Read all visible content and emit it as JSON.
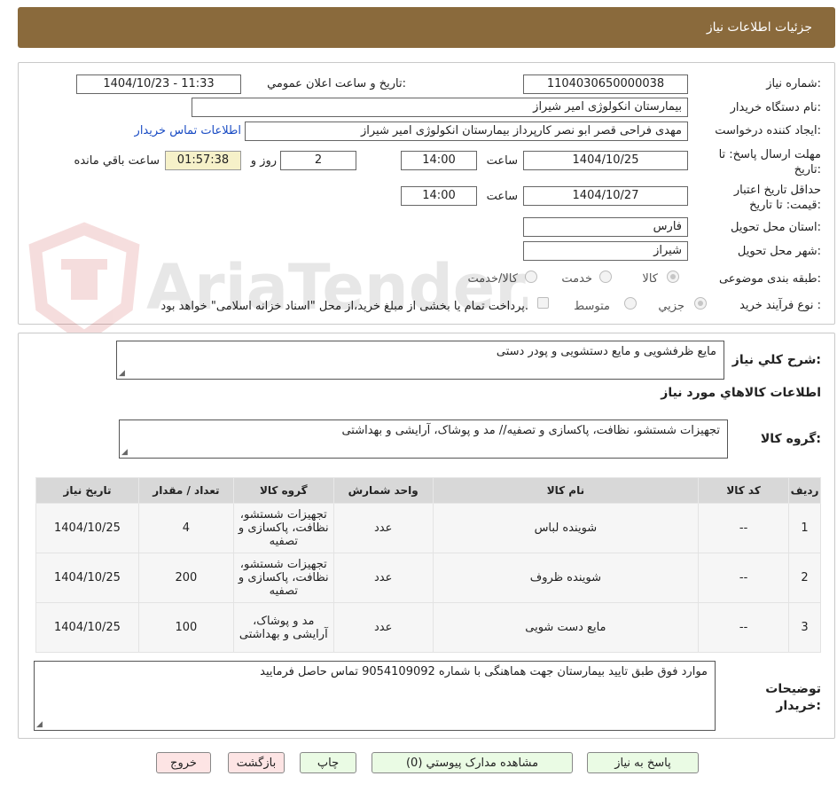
{
  "header": {
    "title": "جزئیات اطلاعات نیاز"
  },
  "form": {
    "need_number_label": "شماره نیاز:",
    "need_number": "1104030650000038",
    "announce_label": "تاریخ و ساعت اعلان عمومي:",
    "announce_value": "1404/10/23 - 11:33",
    "buyer_org_label": "نام دستگاه خریدار:",
    "buyer_org": "بیمارستان انکولوژی امیر شیراز",
    "creator_label": "ایجاد کننده درخواست:",
    "creator": "مهدی فراحی قصر ابو نصر کارپرداز بیمارستان انکولوژی امیر شیراز",
    "buyer_contact_link": "اطلاعات تماس خریدار",
    "deadline_label": "مهلت ارسال پاسخ: تا تاریخ:",
    "deadline_date": "1404/10/25",
    "time_label": "ساعت",
    "deadline_time": "14:00",
    "days_value": "2",
    "days_label": "روز و",
    "remaining_time": "01:57:38",
    "remaining_label": "ساعت باقي مانده",
    "price_validity_label": "حداقل تاریخ اعتبار قیمت: تا تاریخ:",
    "price_validity_date": "1404/10/27",
    "price_validity_time": "14:00",
    "province_label": "استان محل تحویل:",
    "province": "فارس",
    "city_label": "شهر محل تحویل:",
    "city": "شیراز",
    "category_label": "طبقه بندی موضوعی:",
    "category_options": [
      "کالا",
      "خدمت",
      "کالا/خدمت"
    ],
    "process_label": "نوع فرآیند خرید :",
    "process_options": [
      "جزیي",
      "متوسط"
    ],
    "payment_note": "پرداخت تمام یا بخشی از مبلغ خرید،از محل \"اسناد خزانه اسلامی\" خواهد بود."
  },
  "details": {
    "summary_label": "شرح کلي نیاز:",
    "summary": "مایع ظرفشویی و مایع دستشویی و پودر دستی",
    "goods_section_title": "اطلاعات کالاهاي مورد نیاز",
    "goods_group_label": "گروه کالا:",
    "goods_group": "تجهیزات شستشو، نظافت، پاکسازی و تصفیه// مد و پوشاک، آرایشی و بهداشتی"
  },
  "table": {
    "headers": [
      "ردیف",
      "کد کالا",
      "نام کالا",
      "واحد شمارش",
      "گروه کالا",
      "تعداد / مقدار",
      "تاریخ نیاز"
    ],
    "rows": [
      [
        "1",
        "--",
        "شوینده لباس",
        "عدد",
        "تجهیزات شستشو، نظافت، پاکسازی و تصفیه",
        "4",
        "1404/10/25"
      ],
      [
        "2",
        "--",
        "شوینده ظروف",
        "عدد",
        "تجهیزات شستشو، نظافت، پاکسازی و تصفیه",
        "200",
        "1404/10/25"
      ],
      [
        "3",
        "--",
        "مایع دست شویی",
        "عدد",
        "مد و پوشاک، آرایشی و بهداشتی",
        "100",
        "1404/10/25"
      ]
    ]
  },
  "notes": {
    "label": "توضیحات خریدار:",
    "text": "موارد فوق طبق تایید بیمارستان جهت هماهنگی با شماره 9054109092 تماس حاصل فرمایید"
  },
  "buttons": {
    "reply": "پاسخ به نیاز",
    "attachments": "مشاهده مدارک پیوستي (0)",
    "print": "چاپ",
    "back": "بازگشت",
    "exit": "خروج"
  },
  "watermark": {
    "text": "AriaTender.neT"
  },
  "colors": {
    "header_bg": "#8a6a3c",
    "link": "#1a4cc4",
    "button_green": "#eafbe4",
    "button_pink": "#fde4e4",
    "timer_bg": "#f6f1c9"
  }
}
